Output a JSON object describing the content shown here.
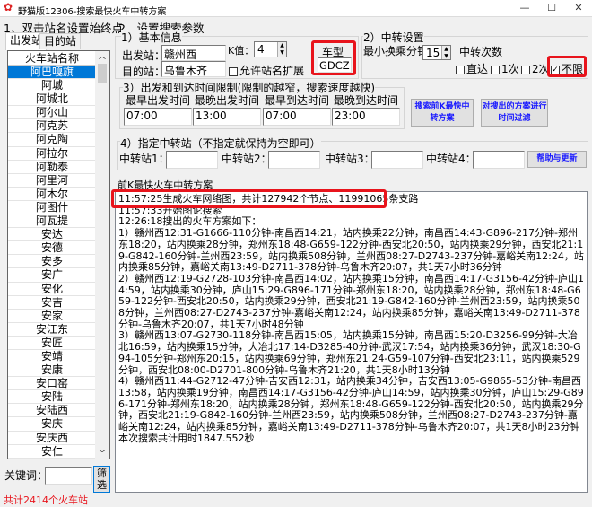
{
  "window": {
    "title": "野猫版12306-搜索最快火车中转方案",
    "min": "—",
    "max": "☐",
    "close": "✕",
    "icon": "cat-logo-icon"
  },
  "left": {
    "section_title": "1、双击站名设置始终点",
    "tabs": [
      {
        "label": "出发站",
        "active": true
      },
      {
        "label": "目的站",
        "active": false
      }
    ],
    "list_header": "火车站名称",
    "stations": [
      "阿巴嘎旗",
      "阿城",
      "阿城北",
      "阿尔山",
      "阿克苏",
      "阿克陶",
      "阿拉尔",
      "阿勒泰",
      "阿里河",
      "阿木尔",
      "阿图什",
      "阿瓦提",
      "安达",
      "安德",
      "安多",
      "安广",
      "安化",
      "安吉",
      "安家",
      "安江东",
      "安匠",
      "安靖",
      "安康",
      "安口窑",
      "安陆",
      "安陆西",
      "安庆",
      "安庆西",
      "安仁"
    ],
    "selected_station": "阿巴嘎旗",
    "keyword_label": "关键词：",
    "keyword_value": "",
    "filter_button": "筛选",
    "total": "共计2414个火车站"
  },
  "params": {
    "section_title": "2、设置搜索参数",
    "basic": {
      "title": "1）基本信息",
      "from_label": "出发站：",
      "from_value": "赣州西",
      "k_label": "K值：",
      "k_value": "4",
      "to_label": "目的站：",
      "to_value": "乌鲁木齐",
      "expand_label": "允许站名扩展",
      "expand_checked": false,
      "train_type_label": "车型",
      "train_type_value": "GDCZ"
    },
    "transfer": {
      "title": "2）中转设置",
      "min_transfer_label": "最小换乘分钟",
      "min_transfer_value": "15",
      "count_label": "中转次数",
      "options": [
        {
          "label": "直达",
          "checked": false
        },
        {
          "label": "1次",
          "checked": false
        },
        {
          "label": "2次",
          "checked": false
        },
        {
          "label": "不限",
          "checked": true
        }
      ]
    },
    "time": {
      "title": "3）出发和到达时间限制(限制的越窄，搜索速度越快)",
      "fields": [
        {
          "label": "最早出发时间",
          "value": "07:00"
        },
        {
          "label": "最晚出发时间",
          "value": "13:00"
        },
        {
          "label": "最早到达时间",
          "value": "07:00"
        },
        {
          "label": "最晚到达时间",
          "value": "23:00"
        }
      ]
    },
    "search_button": "搜索前K最快中转方案",
    "filter_button": "对搜出的方案进行时间过滤",
    "via": {
      "title": "4）指定中转站（不指定就保持为空即可）",
      "fields": [
        {
          "label": "中转站1：",
          "value": ""
        },
        {
          "label": "中转站2：",
          "value": ""
        },
        {
          "label": "中转站3：",
          "value": ""
        },
        {
          "label": "中转站4：",
          "value": ""
        }
      ],
      "help_button": "帮助与更新"
    }
  },
  "results": {
    "title": "前K最快火车中转方案",
    "lines": [
      "11:57:25生成火车网络图，共计127942个节点、11991065条支路",
      "11:57:33开始图论搜索",
      "12:26:18搜出的火车方案如下：",
      "1）赣州西12:31-G1666-110分钟-南昌西14:21，站内换乘22分钟，南昌西14:43-G896-217分钟-郑州东18:20，站内换乘28分钟，郑州东18:48-G659-122分钟-西安北20:50，站内换乘29分钟，西安北21:19-G842-160分钟-兰州西23:59，站内换乘508分钟，兰州西08:27-D2743-237分钟-嘉峪关南12:24，站内换乘85分钟，嘉峪关南13:49-D2711-378分钟-乌鲁木齐20:07，共1天7小时36分钟",
      "2）赣州西12:19-G2728-103分钟-南昌西14:02，站内换乘15分钟，南昌西14:17-G3156-42分钟-庐山14:59，站内换乘30分钟，庐山15:29-G896-171分钟-郑州东18:20，站内换乘28分钟，郑州东18:48-G659-122分钟-西安北20:50，站内换乘29分钟，西安北21:19-G842-160分钟-兰州西23:59，站内换乘508分钟，兰州西08:27-D2743-237分钟-嘉峪关南12:24，站内换乘85分钟，嘉峪关南13:49-D2711-378分钟-乌鲁木齐20:07，共1天7小时48分钟",
      "3）赣州西13:07-G2730-118分钟-南昌西15:05，站内换乘15分钟，南昌西15:20-D3256-99分钟-大冶北16:59，站内换乘15分钟，大冶北17:14-D3285-40分钟-武汉17:54，站内换乘36分钟，武汉18:30-G94-105分钟-郑州东20:15，站内换乘69分钟，郑州东21:24-G59-107分钟-西安北23:11，站内换乘529分钟，西安北08:00-D2701-800分钟-乌鲁木齐21:20，共1天8小时13分钟",
      "4）赣州西11:44-G2712-47分钟-吉安西12:31，站内换乘34分钟，吉安西13:05-G9865-53分钟-南昌西13:58，站内换乘19分钟，南昌西14:17-G3156-42分钟-庐山14:59，站内换乘30分钟，庐山15:29-G896-171分钟-郑州东18:20，站内换乘28分钟，郑州东18:48-G659-122分钟-西安北20:50，站内换乘29分钟，西安北21:19-G842-160分钟-兰州西23:59，站内换乘508分钟，兰州西08:27-D2743-237分钟-嘉峪关南12:24，站内换乘85分钟，嘉峪关南13:49-D2711-378分钟-乌鲁木齐20:07，共1天8小时23分钟",
      "本次搜索共计用时1847.552秒"
    ]
  },
  "colors": {
    "highlight": "#e8141c",
    "selection": "#0078d7",
    "button_text": "#1a1aff",
    "total_text": "#e8141c"
  }
}
